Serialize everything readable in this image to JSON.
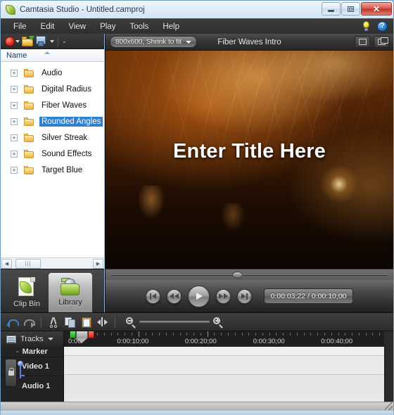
{
  "window": {
    "title": "Camtasia Studio - Untitled.camproj",
    "app_icon": "camtasia-leaf-icon",
    "controls": {
      "minimize": "minimize-button",
      "restore": "restore-button",
      "close_label": "✕"
    }
  },
  "menubar": {
    "items": [
      {
        "label": "File"
      },
      {
        "label": "Edit"
      },
      {
        "label": "View"
      },
      {
        "label": "Play"
      },
      {
        "label": "Tools"
      },
      {
        "label": "Help"
      }
    ],
    "right_icons": [
      {
        "name": "tips-lightbulb-icon"
      },
      {
        "name": "help-question-icon",
        "glyph": "?"
      }
    ]
  },
  "left_panel": {
    "toolbar": {
      "record_label": "record-screen-button",
      "import_media_label": "import-media-button",
      "produce_label": "produce-share-button",
      "overflow_label": "⌄"
    },
    "column_header": {
      "name": "Name",
      "sort": "ascending"
    },
    "tree_items": [
      {
        "label": "Audio",
        "expanded": false,
        "selected": false
      },
      {
        "label": "Digital Radius",
        "expanded": false,
        "selected": false
      },
      {
        "label": "Fiber Waves",
        "expanded": false,
        "selected": false
      },
      {
        "label": "Rounded Angles",
        "expanded": false,
        "selected": true
      },
      {
        "label": "Silver Streak",
        "expanded": false,
        "selected": false
      },
      {
        "label": "Sound Effects",
        "expanded": false,
        "selected": false
      },
      {
        "label": "Target Blue",
        "expanded": false,
        "selected": false
      }
    ],
    "expander_glyph": "+",
    "scrollbar": {
      "left_arrow": "◀",
      "right_arrow": "▶",
      "thumb_grip": "|||"
    },
    "tabs": [
      {
        "label": "Clip Bin",
        "active": false,
        "icon": "clip-bin-icon"
      },
      {
        "label": "Library",
        "active": true,
        "icon": "library-folder-icon"
      }
    ]
  },
  "preview": {
    "dimension_select": {
      "value": "800x600, Shrink to fit",
      "caret": "▼"
    },
    "title": "Fiber Waves Intro",
    "buttons": [
      {
        "name": "fullscreen-button"
      },
      {
        "name": "detach-preview-button"
      }
    ],
    "canvas_title": "Enter Title Here",
    "seek_position_pct": 36,
    "transport": [
      {
        "name": "jump-to-start-button"
      },
      {
        "name": "rewind-button"
      },
      {
        "name": "play-button"
      },
      {
        "name": "fast-forward-button"
      },
      {
        "name": "jump-to-end-button"
      }
    ],
    "timecode": "0:00:03;22 / 0:00:10;00"
  },
  "timeline": {
    "toolbar": [
      {
        "name": "undo-button",
        "label": "Undo"
      },
      {
        "name": "redo-button",
        "label": "Redo"
      },
      {
        "name": "cut-button",
        "label": "Cut"
      },
      {
        "name": "copy-button",
        "label": "Copy"
      },
      {
        "name": "paste-button",
        "label": "Paste"
      },
      {
        "name": "split-button",
        "label": "Split"
      },
      {
        "name": "zoom-out-button",
        "label": "Zoom Out"
      },
      {
        "name": "zoom-in-button",
        "label": "Zoom In"
      }
    ],
    "tracks_button": {
      "label": "Tracks",
      "caret": "▼"
    },
    "ruler": {
      "labels": [
        {
          "text": "0:00",
          "pct": 0
        },
        {
          "text": "0:00:10;00",
          "pct": 21.5
        },
        {
          "text": "0:00:20;00",
          "pct": 42.7
        },
        {
          "text": "0:00:30;00",
          "pct": 64.0
        },
        {
          "text": "0:00:40;00",
          "pct": 85.2
        }
      ]
    },
    "markers": {
      "in_point": "green",
      "out_point": "red",
      "playhead": "gray"
    },
    "tracks": [
      {
        "label": "Marker",
        "prefix": "-",
        "type": "marker"
      },
      {
        "label": "Video 1",
        "type": "video"
      },
      {
        "label": "Audio 1",
        "type": "audio"
      }
    ],
    "lock_button": "track-lock-button"
  },
  "colors": {
    "accent_blue": "#2f7fd2",
    "record_red": "#dd2b18",
    "title_bar": "#dfecf8",
    "chrome_dark": "#2f2f2f",
    "in_point_green": "#24a524",
    "out_point_red": "#d32414"
  }
}
